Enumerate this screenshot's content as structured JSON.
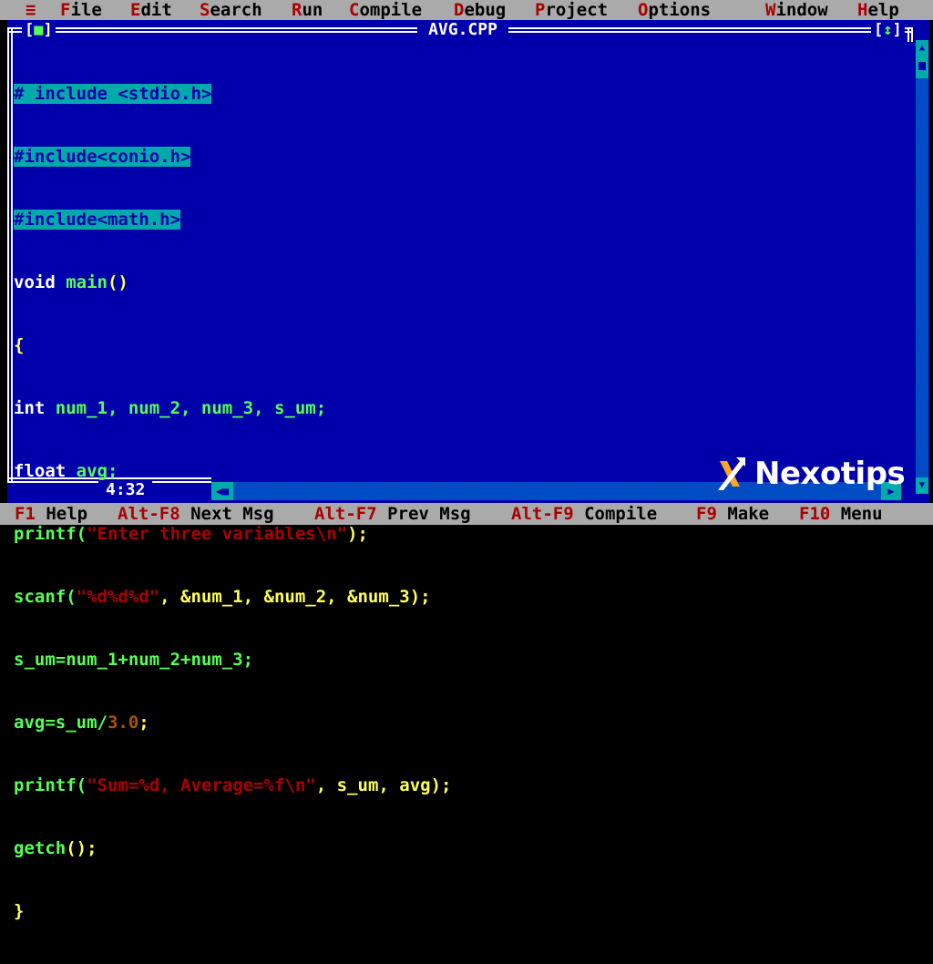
{
  "menubar": {
    "system_icon": "≡",
    "items": [
      {
        "hot": "F",
        "rest": "ile"
      },
      {
        "hot": "E",
        "rest": "dit"
      },
      {
        "hot": "S",
        "rest": "earch"
      },
      {
        "hot": "R",
        "rest": "un"
      },
      {
        "hot": "C",
        "rest": "ompile"
      },
      {
        "hot": "D",
        "rest": "ebug"
      },
      {
        "hot": "P",
        "rest": "roject"
      },
      {
        "hot": "O",
        "rest": "ptions"
      },
      {
        "hot": "W",
        "rest": "indow"
      },
      {
        "hot": "H",
        "rest": "elp"
      }
    ]
  },
  "editor": {
    "title": "AVG.CPP",
    "close_box": "[■]",
    "zoom_box": "[↕]",
    "cursor_position": "4:32",
    "code": {
      "l1": "# include <stdio.h>",
      "l2": "#include<conio.h>",
      "l3": "#include<math.h>",
      "l4a": "void",
      "l4b": " main",
      "l4c": "()",
      "l5": "{",
      "l6a": "int",
      "l6b": " num_1, num_2, num_3, s_um;",
      "l7a": "float",
      "l7b": " avg;",
      "l8a": "printf(",
      "l8b": "\"Enter three variables\\n\"",
      "l8c": ");",
      "l9a": "scanf(",
      "l9b": "\"%d%d%d\"",
      "l9c": ", &num_1, &num_2, &num_3);",
      "l10": "s_um=num_1+num_2+num_3;",
      "l11a": "avg=s_um/",
      "l11b": "3.0",
      "l11c": ";",
      "l12a": "printf(",
      "l12b": "\"Sum=%d, Average=%f\\n\"",
      "l12c": ", s_um, avg);",
      "l13a": "getch",
      "l13b": "();",
      "l14": "}"
    }
  },
  "statusbar": {
    "items": [
      {
        "key": "F1",
        "label": " Help"
      },
      {
        "key": "Alt-F8",
        "label": " Next Msg"
      },
      {
        "key": "Alt-F7",
        "label": " Prev Msg"
      },
      {
        "key": "Alt-F9",
        "label": " Compile"
      },
      {
        "key": "F9",
        "label": " Make"
      },
      {
        "key": "F10",
        "label": " Menu"
      }
    ]
  },
  "watermark": {
    "text": "Nexotips"
  }
}
